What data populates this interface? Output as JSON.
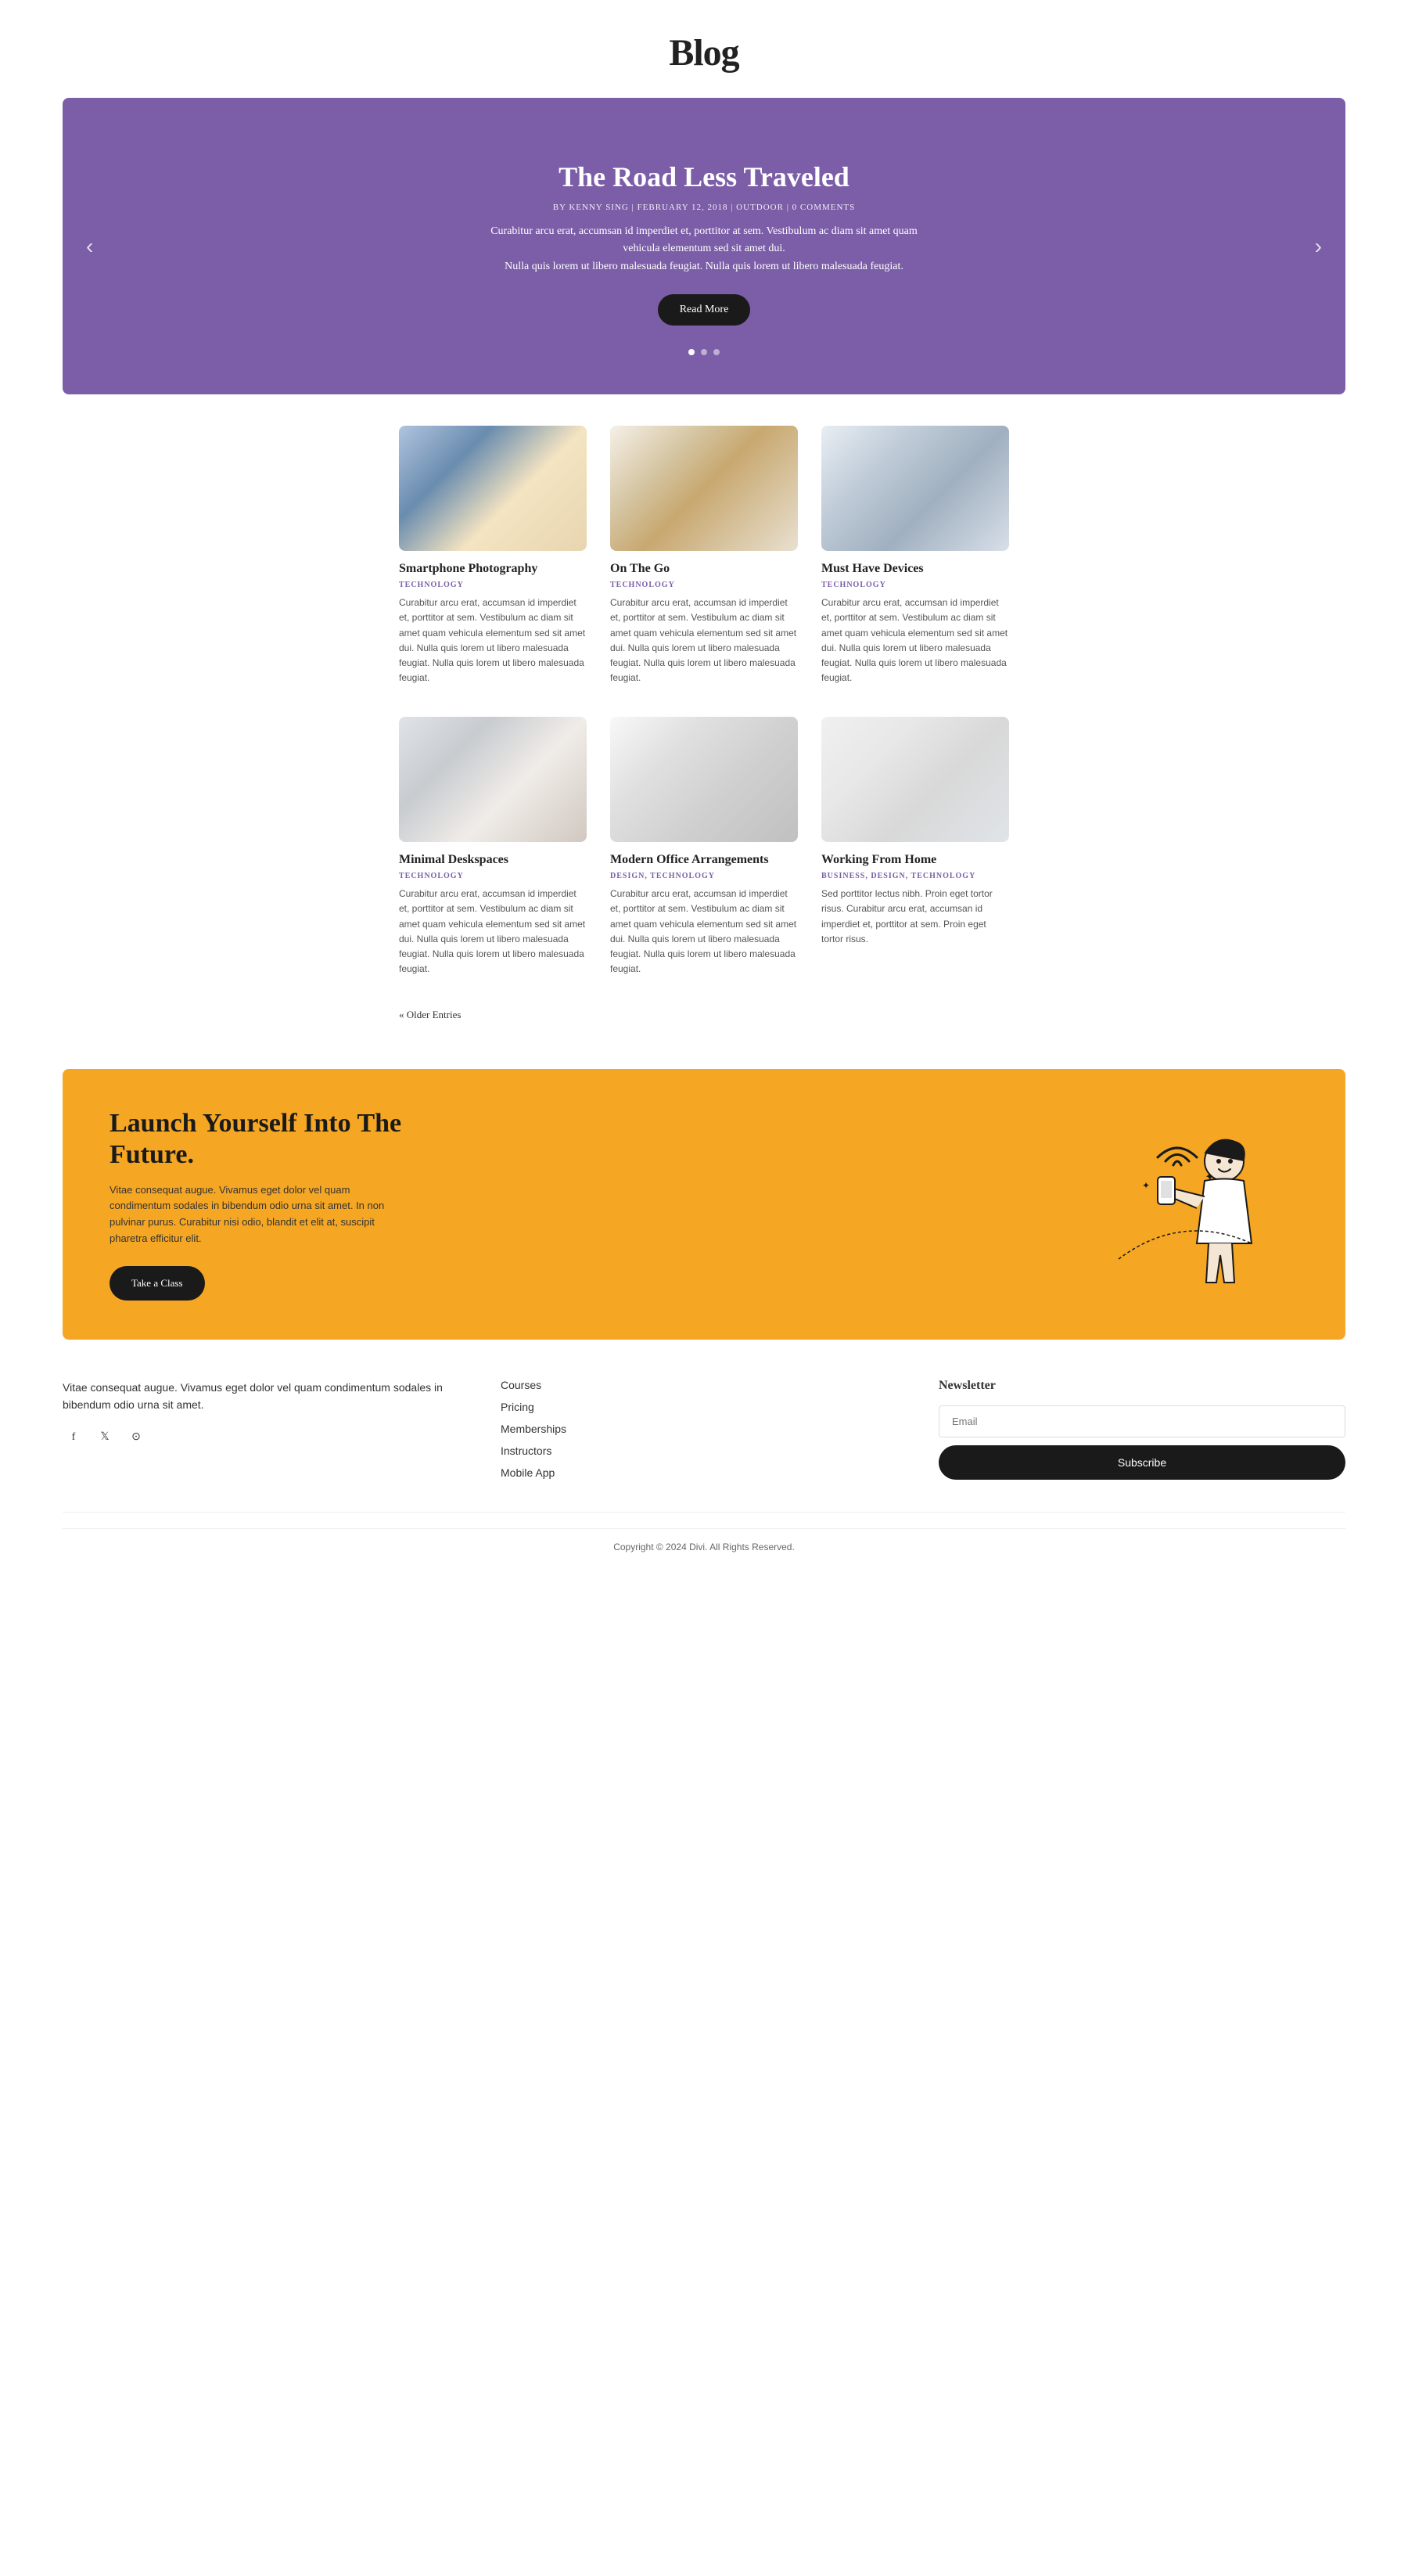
{
  "header": {
    "title": "Blog"
  },
  "hero": {
    "title": "The Road Less Traveled",
    "meta": "BY KENNY SING | FEBRUARY 12, 2018 | OUTDOOR | 0 COMMENTS",
    "description_line1": "Curabitur arcu erat, accumsan id imperdiet et, porttitor at sem. Vestibulum ac diam sit amet quam vehicula elementum sed sit amet dui.",
    "description_line2": "Nulla quis lorem ut libero malesuada feugiat. Nulla quis lorem ut libero malesuada feugiat.",
    "read_more": "Read More",
    "dots": [
      true,
      false,
      false
    ]
  },
  "posts_row1": [
    {
      "title": "Smartphone Photography",
      "category": "TECHNOLOGY",
      "description": "Curabitur arcu erat, accumsan id imperdiet et, porttitor at sem. Vestibulum ac diam sit amet quam vehicula elementum sed sit amet dui. Nulla quis lorem ut libero malesuada feugiat. Nulla quis lorem ut libero malesuada feugiat.",
      "img_class": "img-phone"
    },
    {
      "title": "On The Go",
      "category": "TECHNOLOGY",
      "description": "Curabitur arcu erat, accumsan id imperdiet et, porttitor at sem. Vestibulum ac diam sit amet quam vehicula elementum sed sit amet dui. Nulla quis lorem ut libero malesuada feugiat. Nulla quis lorem ut libero malesuada feugiat.",
      "img_class": "img-tablet"
    },
    {
      "title": "Must Have Devices",
      "category": "TECHNOLOGY",
      "description": "Curabitur arcu erat, accumsan id imperdiet et, porttitor at sem. Vestibulum ac diam sit amet quam vehicula elementum sed sit amet dui. Nulla quis lorem ut libero malesuada feugiat. Nulla quis lorem ut libero malesuada feugiat.",
      "img_class": "img-laptop"
    }
  ],
  "posts_row2": [
    {
      "title": "Minimal Deskspaces",
      "category": "TECHNOLOGY",
      "description": "Curabitur arcu erat, accumsan id imperdiet et, porttitor at sem. Vestibulum ac diam sit amet quam vehicula elementum sed sit amet dui. Nulla quis lorem ut libero malesuada feugiat. Nulla quis lorem ut libero malesuada feugiat.",
      "img_class": "img-keyboard"
    },
    {
      "title": "Modern Office Arrangements",
      "category": "DESIGN, TECHNOLOGY",
      "description": "Curabitur arcu erat, accumsan id imperdiet et, porttitor at sem. Vestibulum ac diam sit amet quam vehicula elementum sed sit amet dui. Nulla quis lorem ut libero malesuada feugiat. Nulla quis lorem ut libero malesuada feugiat.",
      "img_class": "img-monitor"
    },
    {
      "title": "Working From Home",
      "category": "BUSINESS, DESIGN, TECHNOLOGY",
      "description": "Sed porttitor lectus nibh. Proin eget tortor risus. Curabitur arcu erat, accumsan id imperdiet et, porttitor at sem. Proin eget tortor risus.",
      "img_class": "img-home"
    }
  ],
  "older_entries": "« Older Entries",
  "cta": {
    "title": "Launch Yourself Into The Future.",
    "description": "Vitae consequat augue. Vivamus eget dolor vel quam condimentum sodales in bibendum odio urna sit amet. In non pulvinar purus. Curabitur nisi odio, blandit et elit at, suscipit pharetra efficitur elit.",
    "button": "Take a Class"
  },
  "footer": {
    "about_text": "Vitae consequat augue. Vivamus eget dolor vel quam condimentum sodales in bibendum odio urna sit amet.",
    "social": [
      "f",
      "𝕏",
      "ig"
    ],
    "links": {
      "items": [
        "Courses",
        "Pricing",
        "Memberships",
        "Instructors",
        "Mobile App"
      ]
    },
    "newsletter": {
      "title": "Newsletter",
      "placeholder": "Email",
      "button": "Subscribe"
    },
    "copyright": "Copyright © 2024 Divi. All Rights Reserved."
  }
}
